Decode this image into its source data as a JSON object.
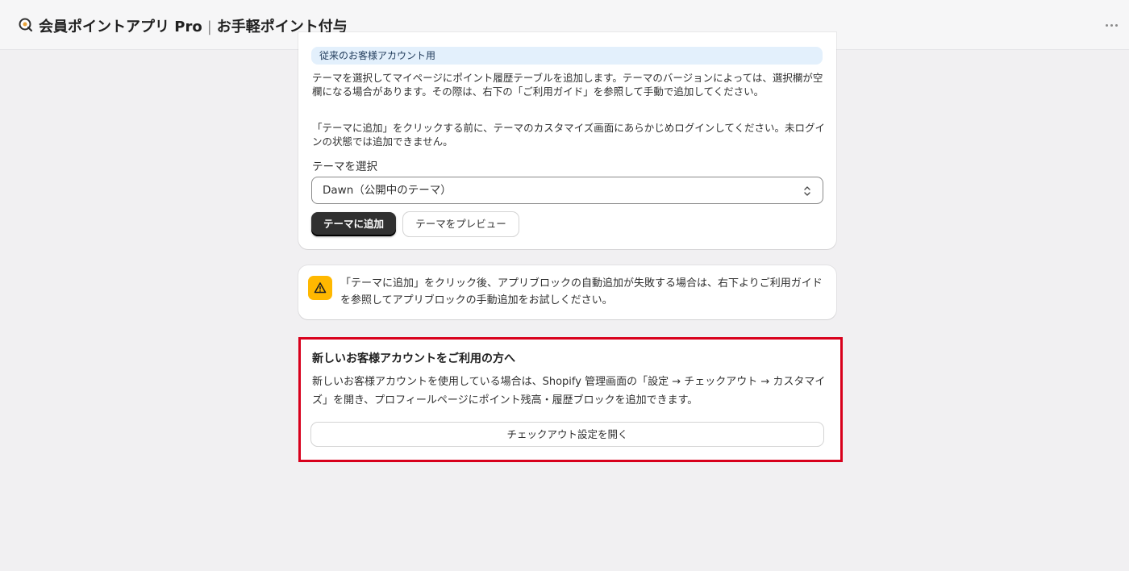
{
  "header": {
    "app_name": "会員ポイントアプリ Pro",
    "separator": "|",
    "page_name": "お手軽ポイント付与"
  },
  "theme_card": {
    "banner": "従来のお客様アカウント用",
    "description_1": "テーマを選択してマイページにポイント履歴テーブルを追加します。テーマのバージョンによっては、選択欄が空欄になる場合があります。その際は、右下の「ご利用ガイド」を参照して手動で追加してください。",
    "description_2": "「テーマに追加」をクリックする前に、テーマのカスタマイズ画面にあらかじめログインしてください。未ログインの状態では追加できません。",
    "select_label": "テーマを選択",
    "select_value": "Dawn（公開中のテーマ）",
    "add_button": "テーマに追加",
    "preview_button": "テーマをプレビュー"
  },
  "warning_card": {
    "text": "「テーマに追加」をクリック後、アプリブロックの自動追加が失敗する場合は、右下よりご利用ガイドを参照してアプリブロックの手動追加をお試しください。"
  },
  "new_account_card": {
    "title": "新しいお客様アカウントをご利用の方へ",
    "text": "新しいお客様アカウントを使用している場合は、Shopify 管理画面の「設定 → チェックアウト → カスタマイズ」を開き、プロフィールページにポイント残高・履歴ブロックを追加できます。",
    "button": "チェックアウト設定を開く"
  },
  "colors": {
    "highlight_border": "#d8001c",
    "warning_icon_bg": "#ffb800",
    "banner_bg": "#e3f0fc",
    "primary_button_bg": "#303030"
  }
}
